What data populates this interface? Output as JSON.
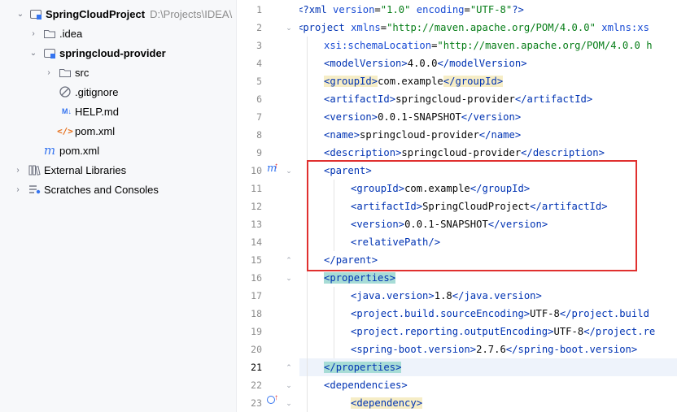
{
  "project_tree": {
    "items": [
      {
        "label": "SpringCloudProject",
        "path": "D:\\Projects\\IDEA\\",
        "icon": "module-folder-icon"
      },
      {
        "label": ".idea",
        "icon": "folder-icon"
      },
      {
        "label": "springcloud-provider",
        "icon": "module-folder-icon"
      },
      {
        "label": "src",
        "icon": "folder-icon"
      },
      {
        "label": ".gitignore",
        "icon": "ignore-file-icon"
      },
      {
        "label": "HELP.md",
        "icon": "markdown-file-icon"
      },
      {
        "label": "pom.xml",
        "icon": "xml-file-icon"
      },
      {
        "label": "pom.xml",
        "icon": "maven-icon"
      },
      {
        "label": "External Libraries",
        "icon": "libraries-icon"
      },
      {
        "label": "Scratches and Consoles",
        "icon": "scratches-icon"
      }
    ]
  },
  "editor": {
    "lines": [
      {
        "n": "1"
      },
      {
        "n": "2"
      },
      {
        "n": "3"
      },
      {
        "n": "4"
      },
      {
        "n": "5"
      },
      {
        "n": "6"
      },
      {
        "n": "7"
      },
      {
        "n": "8"
      },
      {
        "n": "9"
      },
      {
        "n": "10"
      },
      {
        "n": "11"
      },
      {
        "n": "12"
      },
      {
        "n": "13"
      },
      {
        "n": "14"
      },
      {
        "n": "15"
      },
      {
        "n": "16"
      },
      {
        "n": "17"
      },
      {
        "n": "18"
      },
      {
        "n": "19"
      },
      {
        "n": "20"
      },
      {
        "n": "21"
      },
      {
        "n": "22"
      },
      {
        "n": "23"
      }
    ],
    "current_line": "21",
    "gutter_marks": {
      "line10": "m",
      "line23": "↑"
    },
    "code": {
      "l1": {
        "decl_open": "<?",
        "decl_name": "xml",
        "a1": "version",
        "eq": "=",
        "v1": "\"1.0\"",
        "a2": "encoding",
        "v2": "\"UTF-8\"",
        "decl_close": "?>"
      },
      "l2": {
        "open": "<",
        "name": "project",
        "a1": "xmlns",
        "v1": "\"http://maven.apache.org/POM/4.0.0\"",
        "a2": "xmlns:xs"
      },
      "l3": {
        "a1": "xsi:schemaLocation",
        "v1": "\"http://maven.apache.org/POM/4.0.0 h"
      },
      "l4": {
        "tag": "modelVersion",
        "text": "4.0.0"
      },
      "l5": {
        "tag": "groupId",
        "text": "com.example"
      },
      "l6": {
        "tag": "artifactId",
        "text": "springcloud-provider"
      },
      "l7": {
        "tag": "version",
        "text": "0.0.1-SNAPSHOT"
      },
      "l8": {
        "tag": "name",
        "text": "springcloud-provider"
      },
      "l9": {
        "tag": "description",
        "text": "springcloud-provider"
      },
      "l10": {
        "tag": "parent"
      },
      "l11": {
        "tag": "groupId",
        "text": "com.example"
      },
      "l12": {
        "tag": "artifactId",
        "text": "SpringCloudProject"
      },
      "l13": {
        "tag": "version",
        "text": "0.0.1-SNAPSHOT"
      },
      "l14": {
        "tag": "relativePath"
      },
      "l15": {
        "tag": "parent"
      },
      "l16": {
        "tag": "properties"
      },
      "l17": {
        "tag": "java.version",
        "text": "1.8"
      },
      "l18": {
        "tag": "project.build.sourceEncoding",
        "text": "UTF-8",
        "tag_close": "project.build"
      },
      "l19": {
        "tag": "project.reporting.outputEncoding",
        "text": "UTF-8",
        "tag_close": "project.re"
      },
      "l20": {
        "tag": "spring-boot.version",
        "text": "2.7.6"
      },
      "l21": {
        "tag": "properties"
      },
      "l22": {
        "tag": "dependencies"
      },
      "l23": {
        "tag": "dependency"
      }
    }
  },
  "colors": {
    "tag": "#0033b3",
    "attribute": "#174ad4",
    "string": "#067d17",
    "highlight_red_box": "#e0302f",
    "tag_highlight": "#f6edc6",
    "matched_tag_highlight": "#a7dcd6"
  }
}
